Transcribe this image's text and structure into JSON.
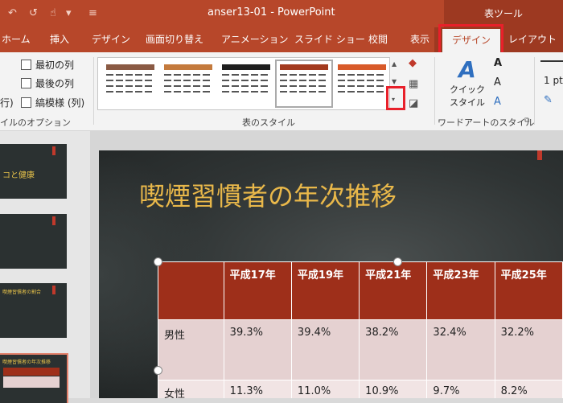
{
  "titlebar": {
    "doc_title": "anser13-01  -  PowerPoint",
    "context_group": "表ツール"
  },
  "tabs": [
    {
      "label": "ホーム"
    },
    {
      "label": "挿入"
    },
    {
      "label": "デザイン"
    },
    {
      "label": "画面切り替え"
    },
    {
      "label": "アニメーション"
    },
    {
      "label": "スライド ショー"
    },
    {
      "label": "校閲"
    },
    {
      "label": "表示"
    },
    {
      "label": "デザイン",
      "active": true
    },
    {
      "label": "レイアウト"
    }
  ],
  "ribbon": {
    "options": {
      "first_col": "最初の列",
      "last_col": "最後の列",
      "banded_cols": "縞模様 (列)",
      "row_partial": "行)",
      "group_label": "イルのオプション"
    },
    "styles_group_label": "表のスタイル",
    "wordart": {
      "quick_style": [
        "クイック",
        "スタイル"
      ],
      "group_label": "ワードアートのスタイル"
    },
    "pen_weight": "1 pt"
  },
  "colors": {
    "accent": "#b7472a",
    "highlight_box": "#e8202a",
    "table_header": "#9e2f1a",
    "title_text": "#e9b84a"
  },
  "slides": [
    {
      "caption": "コと健康"
    },
    {
      "caption": ""
    },
    {
      "caption": "喫煙習慣者の割合"
    },
    {
      "caption": "喫煙習慣者の年次推移"
    }
  ],
  "slide": {
    "title": "喫煙習慣者の年次推移",
    "table": {
      "headers": [
        "",
        "平成17年",
        "平成19年",
        "平成21年",
        "平成23年",
        "平成25年"
      ],
      "rows": [
        [
          "男性",
          "39.3%",
          "39.4%",
          "38.2%",
          "32.4%",
          "32.2%"
        ],
        [
          "女性",
          "11.3%",
          "11.0%",
          "10.9%",
          "9.7%",
          "8.2%"
        ]
      ]
    }
  }
}
